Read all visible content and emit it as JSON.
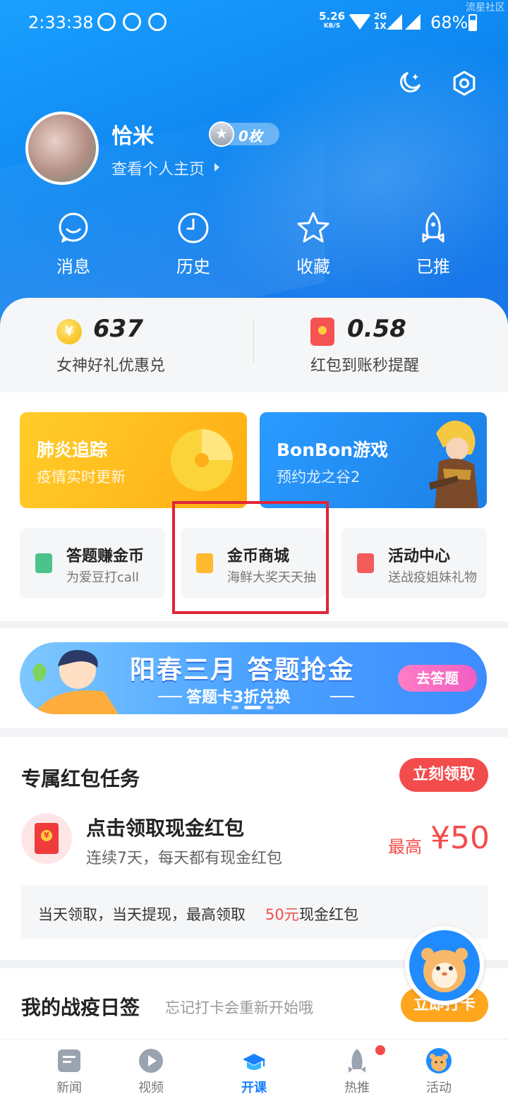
{
  "status_bar": {
    "time": "2:33:38",
    "speed_value": "5.26",
    "speed_unit": "KB/S",
    "net_top": "2G",
    "net_bottom": "1X",
    "battery": "68%",
    "corner_watermark": "流星社区"
  },
  "profile": {
    "name": "恰米",
    "link": "查看个人主页",
    "badge": "0枚"
  },
  "quick_actions": [
    {
      "label": "消息",
      "icon": "message-icon"
    },
    {
      "label": "历史",
      "icon": "clock-icon"
    },
    {
      "label": "收藏",
      "icon": "star-icon"
    },
    {
      "label": "已推",
      "icon": "rocket-icon"
    }
  ],
  "assets": {
    "coins": {
      "value": "637",
      "sub": "女神好礼优惠兑",
      "symbol": "¥"
    },
    "redpacket": {
      "value": "0.58",
      "sub": "红包到账秒提醒"
    }
  },
  "features": {
    "big": [
      {
        "title": "肺炎追踪",
        "sub": "疫情实时更新"
      },
      {
        "title": "BonBon游戏",
        "sub": "预约龙之谷2"
      }
    ],
    "small": [
      {
        "title": "答题赚金币",
        "sub": "为爱豆打call",
        "color": "#4cc38a"
      },
      {
        "title": "金币商城",
        "sub": "海鲜大奖天天抽",
        "color": "#ffb92e"
      },
      {
        "title": "活动中心",
        "sub": "送战疫姐妹礼物",
        "color": "#f45b5b"
      }
    ]
  },
  "promo": {
    "title": "阳春三月 答题抢金",
    "sub": "答题卡3折兑换",
    "button": "去答题"
  },
  "task": {
    "title": "专属红包任务",
    "button": "立刻领取",
    "name": "点击领取现金红包",
    "desc": "连续7天，每天都有现金红包",
    "max_label": "最高",
    "amount": "¥50",
    "note_prefix": "当天领取，当天提现，最高领取",
    "note_highlight": "50元",
    "note_suffix": "现金红包"
  },
  "checkin": {
    "title": "我的战疫日签",
    "sub": "忘记打卡会重新开始哦",
    "button": "立即打卡"
  },
  "tabbar": [
    {
      "label": "新闻",
      "icon": "news-icon"
    },
    {
      "label": "视频",
      "icon": "video-icon"
    },
    {
      "label": "开课",
      "icon": "course-icon",
      "active": true
    },
    {
      "label": "热推",
      "icon": "rocket-icon"
    },
    {
      "label": "活动",
      "icon": "activity-icon"
    }
  ],
  "colors": {
    "primary_blue": "#1a80ff",
    "red": "#f34c4c",
    "orange": "#ffa51e"
  }
}
